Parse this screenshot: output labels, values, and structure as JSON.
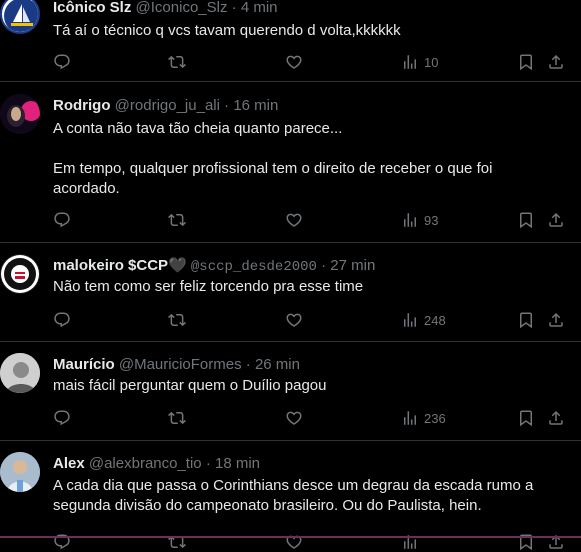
{
  "tweets": [
    {
      "name": "Icônico Slz",
      "handle": "@Iconico_Slz",
      "sep": "·",
      "time": "4 min",
      "text": "Tá aí o técnico q vcs tavam querendo d volta,kkkkkk",
      "views": "10"
    },
    {
      "name": "Rodrigo",
      "handle": "@rodrigo_ju_ali",
      "sep": "·",
      "time": "16 min",
      "text": "A conta não tava tão cheia quanto parece...\n\nEm tempo, qualquer profissional tem o direito de receber o que foi\nacordado.",
      "views": "93"
    },
    {
      "name": "malokeiro $CCP",
      "name_emoji": "🖤",
      "handle": "@sccp_desde2000",
      "sep": "·",
      "time": "27 min",
      "text": "Não tem como ser feliz torcendo pra esse time",
      "views": "248"
    },
    {
      "name": "Maurício",
      "handle": "@MauricioFormes",
      "sep": "·",
      "time": "26 min",
      "text": "mais fácil perguntar quem o Duílio pagou",
      "views": "236"
    },
    {
      "name": "Alex",
      "handle": "@alexbranco_tio",
      "sep": "·",
      "time": "18 min",
      "text": "A cada dia que passa o Corinthians desce um degrau da escada rumo a\nsegunda divisão do campeonato brasileiro. Ou do Paulista, hein.",
      "views": ""
    }
  ],
  "icons": [
    "reply-icon",
    "retweet-icon",
    "like-icon",
    "views-icon",
    "bookmark-icon",
    "share-icon",
    "more-icon"
  ]
}
